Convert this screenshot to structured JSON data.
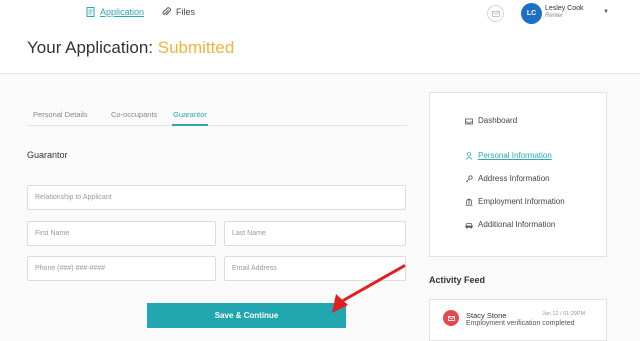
{
  "nav": {
    "application_label": "Application",
    "files_label": "Files"
  },
  "user": {
    "initials": "LC",
    "name": "Lesley Cook",
    "role": "Renter"
  },
  "page": {
    "title": "Your Application: ",
    "status": "Submitted"
  },
  "tabs": [
    {
      "label": "Personal Details",
      "active": false
    },
    {
      "label": "Co-occupants",
      "active": false
    },
    {
      "label": "Guarantor",
      "active": true
    }
  ],
  "form": {
    "section_title": "Guarantor",
    "relationship_placeholder": "Relationship to Applicant",
    "first_name_placeholder": "First Name",
    "last_name_placeholder": "Last Name",
    "phone_placeholder": "Phone (###) ###-####",
    "email_placeholder": "Email Address",
    "save_label": "Save & Continue"
  },
  "sidebar": {
    "items": [
      {
        "label": "Dashboard",
        "icon": "inbox-icon"
      },
      {
        "label": "Personal Information",
        "icon": "person-icon",
        "active": true
      },
      {
        "label": "Address Information",
        "icon": "key-icon"
      },
      {
        "label": "Employment Information",
        "icon": "bank-icon"
      },
      {
        "label": "Additional Information",
        "icon": "car-icon"
      }
    ]
  },
  "activity": {
    "title": "Activity Feed",
    "items": [
      {
        "name": "Stacy Stone",
        "date": "Jan 12 / 01:29PM",
        "text": "Employment verification completed",
        "icon": "mail-icon"
      }
    ]
  },
  "colors": {
    "accent": "#2aa8b3",
    "status": "#f0b43c",
    "avatar": "#1d6fc4",
    "feed_icon": "#e5484d",
    "arrow": "#e02020"
  }
}
